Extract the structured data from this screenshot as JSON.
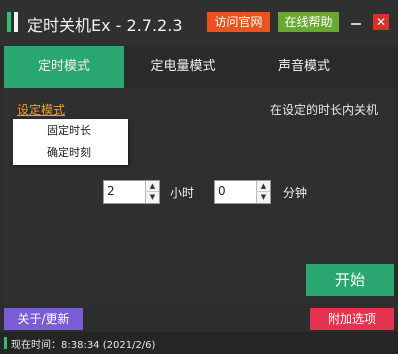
{
  "app": {
    "title": "定时关机Ex - 2.7.2.3",
    "visit_site_label": "访问官网",
    "online_help_label": "在线帮助",
    "close_glyph": "✕"
  },
  "tabs": [
    {
      "label": "定时模式",
      "active": true
    },
    {
      "label": "定电量模式",
      "active": false
    },
    {
      "label": "声音模式",
      "active": false
    }
  ],
  "panel": {
    "mode_link": "设定模式",
    "description": "在设定的时长内关机",
    "dropdown": [
      "固定时长",
      "确定时刻"
    ],
    "hours": {
      "value": "2",
      "unit": "小时"
    },
    "minutes": {
      "value": "0",
      "unit": "分钟"
    },
    "start_label": "开始"
  },
  "footer": {
    "about_label": "关于/更新",
    "extra_options_label": "附加选项",
    "status_text": "现在时间：8:38:34 (2021/2/6)"
  },
  "colors": {
    "accent_green": "#2aa771",
    "visit_site": "#e8531f",
    "online_help": "#6aa834",
    "close": "#d9302c",
    "about": "#7a5dd4",
    "extra": "#e5334f",
    "link_orange": "#f0a030"
  }
}
